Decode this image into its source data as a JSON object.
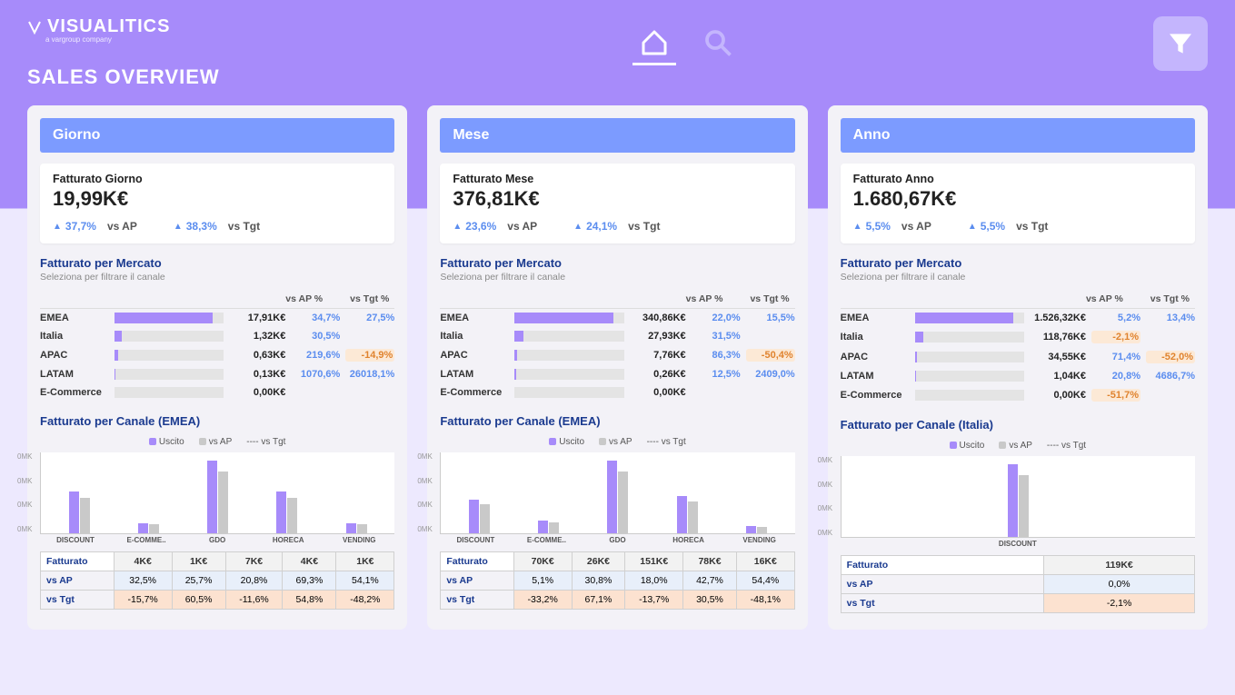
{
  "brand": {
    "name": "VISUALITICS",
    "tagline": "a vargroup company",
    "page_title": "SALES OVERVIEW"
  },
  "nav": {
    "home_icon": "home",
    "search_icon": "search",
    "filter_icon": "filter"
  },
  "labels": {
    "vs_ap": "vs AP",
    "vs_tgt": "vs Tgt",
    "vs_ap_pct": "vs AP %",
    "vs_tgt_pct": "vs Tgt %",
    "mercato_title": "Fatturato per Mercato",
    "mercato_sub": "Seleziona per filtrare il canale",
    "legend_uscito": "Uscito",
    "legend_vsap": "vs AP",
    "legend_vstgt": "vs Tgt",
    "fatturato": "Fatturato"
  },
  "cards": [
    {
      "id": "giorno",
      "title": "Giorno",
      "kpi": {
        "label": "Fatturato Giorno",
        "value": "19,99K€",
        "ap": "37,7%",
        "tgt": "38,3%"
      },
      "mercato": [
        {
          "name": "EMEA",
          "val": "17,91K€",
          "ap": "34,7%",
          "tgt": "27,5%",
          "bar": 90,
          "neg": false
        },
        {
          "name": "Italia",
          "val": "1,32K€",
          "ap": "30,5%",
          "tgt": "",
          "bar": 7,
          "neg": false
        },
        {
          "name": "APAC",
          "val": "0,63K€",
          "ap": "219,6%",
          "tgt": "-14,9%",
          "bar": 3,
          "neg": true
        },
        {
          "name": "LATAM",
          "val": "0,13K€",
          "ap": "1070,6%",
          "tgt": "26018,1%",
          "bar": 1,
          "neg": false
        },
        {
          "name": "E-Commerce",
          "val": "0,00K€",
          "ap": "",
          "tgt": "",
          "bar": 0,
          "neg": false
        }
      ],
      "canale_title": "Fatturato per Canale (EMEA)",
      "canale_cats": [
        "DISCOUNT",
        "E-COMME..",
        "GDO",
        "HORECA",
        "VENDING"
      ],
      "table": {
        "fatturato": [
          "4K€",
          "1K€",
          "7K€",
          "4K€",
          "1K€"
        ],
        "vs_ap": [
          "32,5%",
          "25,7%",
          "20,8%",
          "69,3%",
          "54,1%"
        ],
        "vs_tgt": [
          "-15,7%",
          "60,5%",
          "-11,6%",
          "54,8%",
          "-48,2%"
        ]
      }
    },
    {
      "id": "mese",
      "title": "Mese",
      "kpi": {
        "label": "Fatturato Mese",
        "value": "376,81K€",
        "ap": "23,6%",
        "tgt": "24,1%"
      },
      "mercato": [
        {
          "name": "EMEA",
          "val": "340,86K€",
          "ap": "22,0%",
          "tgt": "15,5%",
          "bar": 90,
          "neg": false
        },
        {
          "name": "Italia",
          "val": "27,93K€",
          "ap": "31,5%",
          "tgt": "",
          "bar": 8,
          "neg": false
        },
        {
          "name": "APAC",
          "val": "7,76K€",
          "ap": "86,3%",
          "tgt": "-50,4%",
          "bar": 2,
          "neg": true
        },
        {
          "name": "LATAM",
          "val": "0,26K€",
          "ap": "12,5%",
          "tgt": "2409,0%",
          "bar": 1,
          "neg": false
        },
        {
          "name": "E-Commerce",
          "val": "0,00K€",
          "ap": "",
          "tgt": "",
          "bar": 0,
          "neg": false
        }
      ],
      "canale_title": "Fatturato per Canale (EMEA)",
      "canale_cats": [
        "DISCOUNT",
        "E-COMME..",
        "GDO",
        "HORECA",
        "VENDING"
      ],
      "table": {
        "fatturato": [
          "70K€",
          "26K€",
          "151K€",
          "78K€",
          "16K€"
        ],
        "vs_ap": [
          "5,1%",
          "30,8%",
          "18,0%",
          "42,7%",
          "54,4%"
        ],
        "vs_tgt": [
          "-33,2%",
          "67,1%",
          "-13,7%",
          "30,5%",
          "-48,1%"
        ]
      }
    },
    {
      "id": "anno",
      "title": "Anno",
      "kpi": {
        "label": "Fatturato Anno",
        "value": "1.680,67K€",
        "ap": "5,5%",
        "tgt": "5,5%"
      },
      "mercato": [
        {
          "name": "EMEA",
          "val": "1.526,32K€",
          "ap": "5,2%",
          "tgt": "13,4%",
          "bar": 90,
          "neg": false
        },
        {
          "name": "Italia",
          "val": "118,76K€",
          "ap": "-2,1%",
          "tgt": "",
          "bar": 8,
          "neg": false,
          "ap_neg": true
        },
        {
          "name": "APAC",
          "val": "34,55K€",
          "ap": "71,4%",
          "tgt": "-52,0%",
          "bar": 2,
          "neg": true
        },
        {
          "name": "LATAM",
          "val": "1,04K€",
          "ap": "20,8%",
          "tgt": "4686,7%",
          "bar": 1,
          "neg": false
        },
        {
          "name": "E-Commerce",
          "val": "0,00K€",
          "ap": "-51,7%",
          "tgt": "",
          "bar": 0,
          "neg": false,
          "ap_neg": true
        }
      ],
      "canale_title": "Fatturato per Canale (Italia)",
      "canale_cats": [
        "DISCOUNT"
      ],
      "table": {
        "fatturato": [
          "119K€"
        ],
        "vs_ap": [
          "0,0%"
        ],
        "vs_tgt": [
          "-2,1%"
        ]
      }
    }
  ],
  "chart_data": [
    {
      "card": "giorno",
      "type": "bar",
      "title": "Fatturato per Canale (EMEA)",
      "categories": [
        "DISCOUNT",
        "E-COMMERCE",
        "GDO",
        "HORECA",
        "VENDING"
      ],
      "series": [
        {
          "name": "Uscito",
          "values": [
            4,
            1,
            7,
            4,
            1
          ]
        },
        {
          "name": "vs AP",
          "values": [
            32.5,
            25.7,
            20.8,
            69.3,
            54.1
          ]
        },
        {
          "name": "vs Tgt",
          "values": [
            -15.7,
            60.5,
            -11.6,
            54.8,
            -48.2
          ]
        }
      ],
      "ylabel": "0MK",
      "xlabel": ""
    },
    {
      "card": "mese",
      "type": "bar",
      "title": "Fatturato per Canale (EMEA)",
      "categories": [
        "DISCOUNT",
        "E-COMMERCE",
        "GDO",
        "HORECA",
        "VENDING"
      ],
      "series": [
        {
          "name": "Uscito",
          "values": [
            70,
            26,
            151,
            78,
            16
          ]
        },
        {
          "name": "vs AP",
          "values": [
            5.1,
            30.8,
            18.0,
            42.7,
            54.4
          ]
        },
        {
          "name": "vs Tgt",
          "values": [
            -33.2,
            67.1,
            -13.7,
            30.5,
            -48.1
          ]
        }
      ],
      "ylabel": "0MK",
      "xlabel": ""
    },
    {
      "card": "anno",
      "type": "bar",
      "title": "Fatturato per Canale (Italia)",
      "categories": [
        "DISCOUNT"
      ],
      "series": [
        {
          "name": "Uscito",
          "values": [
            119
          ]
        },
        {
          "name": "vs AP",
          "values": [
            0.0
          ]
        },
        {
          "name": "vs Tgt",
          "values": [
            -2.1
          ]
        }
      ],
      "ylabel": "0MK",
      "xlabel": ""
    }
  ]
}
